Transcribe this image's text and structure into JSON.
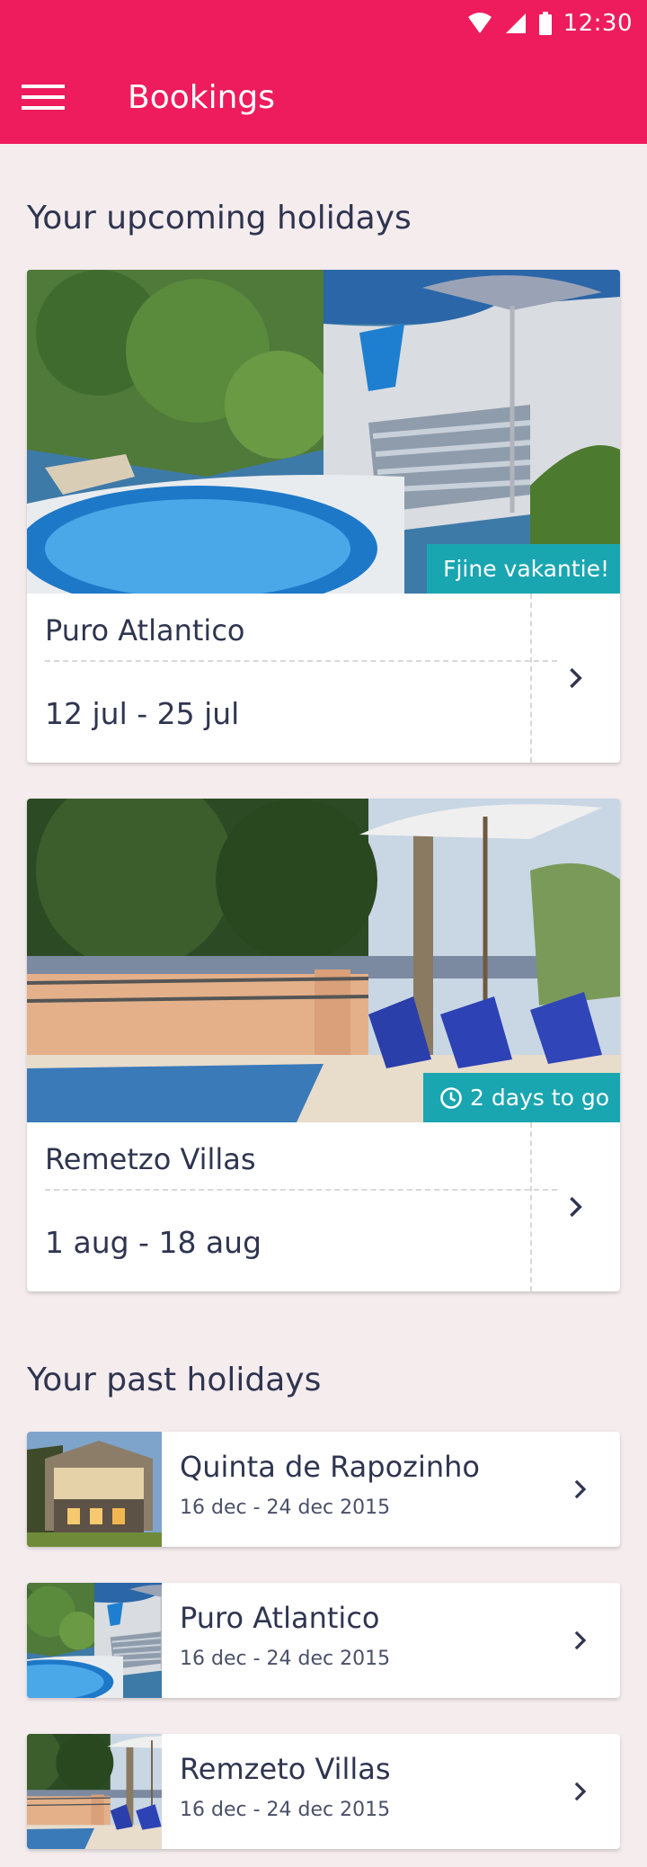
{
  "status_bar": {
    "time": "12:30",
    "icons": [
      "wifi-icon",
      "signal-icon",
      "battery-icon"
    ]
  },
  "app_bar": {
    "title": "Bookings",
    "menu_icon": "hamburger-menu-icon",
    "color": "#ee1c5c"
  },
  "upcoming": {
    "heading": "Your upcoming holidays",
    "items": [
      {
        "name": "Puro Atlantico",
        "dates": "12 jul - 25 jul",
        "badge": "Fjine vakantie!",
        "badge_icon": "",
        "image": "pool-terrace-photo"
      },
      {
        "name": "Remetzo Villas",
        "dates": "1 aug - 18 aug",
        "badge": "2 days to go",
        "badge_icon": "clock-icon",
        "image": "villa-pool-photo"
      }
    ]
  },
  "past": {
    "heading": "Your past holidays",
    "items": [
      {
        "name": "Quinta de Rapozinho",
        "dates": "16 dec - 24 dec 2015"
      },
      {
        "name": "Puro Atlantico",
        "dates": "16 dec - 24 dec 2015"
      },
      {
        "name": "Remzeto Villas",
        "dates": "16 dec - 24 dec 2015"
      }
    ]
  },
  "colors": {
    "accent": "#ee1c5c",
    "badge": "#1aa6b1",
    "background": "#f5ecee",
    "text": "#2f3550"
  }
}
